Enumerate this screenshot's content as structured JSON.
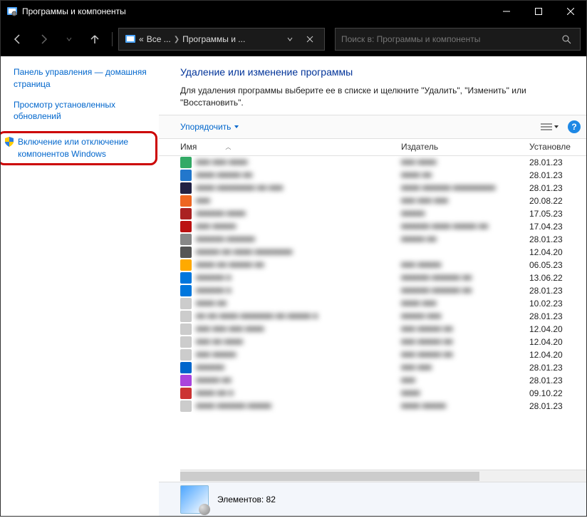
{
  "titlebar": {
    "title": "Программы и компоненты"
  },
  "breadcrumb": {
    "prefix": "«",
    "seg1": "Все ...",
    "seg2": "Программы и ..."
  },
  "search": {
    "placeholder": "Поиск в: Программы и компоненты"
  },
  "sidebar": {
    "link1": "Панель управления — домашняя страница",
    "link2": "Просмотр установленных обновлений",
    "link3": "Включение или отключение компонентов Windows"
  },
  "main": {
    "title": "Удаление или изменение программы",
    "subtitle": "Для удаления программы выберите ее в списке и щелкните \"Удалить\", \"Изменить\" или \"Восстановить\"."
  },
  "toolbar": {
    "organize": "Упорядочить"
  },
  "columns": {
    "name": "Имя",
    "publisher": "Издатель",
    "installed": "Установле"
  },
  "rows": [
    {
      "icon": "#3a6",
      "name": "■■■ ■■■ ■■■■",
      "pub": "■■■ ■■■■",
      "date": "28.01.23"
    },
    {
      "icon": "#27c",
      "name": "■■■■ ■■■■■ ■■",
      "pub": "■■■■ ■■",
      "date": "28.01.23"
    },
    {
      "icon": "#224",
      "name": "■■■■ ■■■■■■■■ ■■ ■■■",
      "pub": "■■■■ ■■■■■■ ■■■■■■■■■",
      "date": "28.01.23"
    },
    {
      "icon": "#e62",
      "name": "■■■",
      "pub": "■■■ ■■■ ■■■",
      "date": "20.08.22"
    },
    {
      "icon": "#a22",
      "name": "■■■■■■ ■■■■",
      "pub": "■■■■■",
      "date": "17.05.23"
    },
    {
      "icon": "#b11",
      "name": "■■■ ■■■■■",
      "pub": "■■■■■■ ■■■■ ■■■■■ ■■",
      "date": "17.04.23"
    },
    {
      "icon": "#888",
      "name": "■■■■■■ ■■■■■■",
      "pub": "■■■■■ ■■",
      "date": "28.01.23"
    },
    {
      "icon": "#555",
      "name": "■■■■■ ■■ ■■■■ ■■■■■■■■",
      "pub": "",
      "date": "12.04.20"
    },
    {
      "icon": "#fa0",
      "name": "■■■■ ■■ ■■■■■ ■■",
      "pub": "■■■ ■■■■■",
      "date": "06.05.23"
    },
    {
      "icon": "#07d",
      "name": "■■■■■■ ■",
      "pub": "■■■■■■ ■■■■■■ ■■",
      "date": "13.06.22"
    },
    {
      "icon": "#07d",
      "name": "■■■■■■ ■",
      "pub": "■■■■■■ ■■■■■■ ■■",
      "date": "28.01.23"
    },
    {
      "icon": "#ccc",
      "name": "■■■■ ■■",
      "pub": "■■■■ ■■■",
      "date": "10.02.23"
    },
    {
      "icon": "#ccc",
      "name": "■■ ■■ ■■■■ ■■■■■■■ ■■ ■■■■■ ■",
      "pub": "■■■■■ ■■■",
      "date": "28.01.23"
    },
    {
      "icon": "#ccc",
      "name": "■■■ ■■■ ■■■ ■■■■",
      "pub": "■■■ ■■■■■ ■■",
      "date": "12.04.20"
    },
    {
      "icon": "#ccc",
      "name": "■■■ ■■ ■■■■",
      "pub": "■■■ ■■■■■ ■■",
      "date": "12.04.20"
    },
    {
      "icon": "#ccc",
      "name": "■■■ ■■■■■",
      "pub": "■■■ ■■■■■ ■■",
      "date": "12.04.20"
    },
    {
      "icon": "#06c",
      "name": "■■■■■■",
      "pub": "■■■ ■■■",
      "date": "28.01.23"
    },
    {
      "icon": "#a4d",
      "name": "■■■■■ ■■",
      "pub": "■■■",
      "date": "28.01.23"
    },
    {
      "icon": "#c33",
      "name": "■■■■ ■■ ■",
      "pub": "■■■■",
      "date": "09.10.22"
    },
    {
      "icon": "#ccc",
      "name": "■■■■ ■■■■■■ ■■■■■",
      "pub": "■■■■ ■■■■■",
      "date": "28.01.23"
    }
  ],
  "status": {
    "count_label": "Элементов:",
    "count": "82"
  }
}
